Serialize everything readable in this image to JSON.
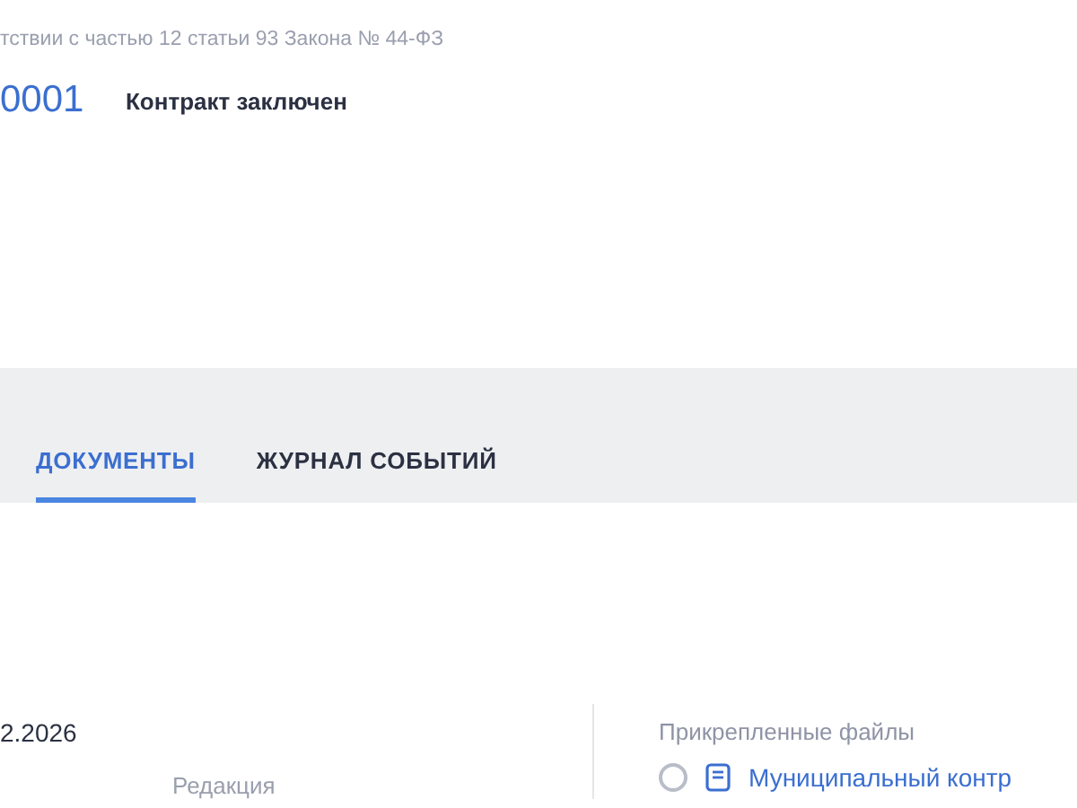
{
  "header": {
    "basis": "тствии с частью 12 статьи 93 Закона № 44-ФЗ",
    "number": "0001",
    "status": "Контракт заключен"
  },
  "tabs": [
    {
      "label": "ДОКУМЕНТЫ",
      "selected": true
    },
    {
      "label": "ЖУРНАЛ СОБЫТИЙ",
      "selected": false
    }
  ],
  "document": {
    "date": "2.2026",
    "column_label": "Редакция"
  },
  "attachments": {
    "title": "Прикрепленные файлы",
    "files": [
      {
        "name": "Муниципальный контр",
        "selected": false
      }
    ]
  }
}
